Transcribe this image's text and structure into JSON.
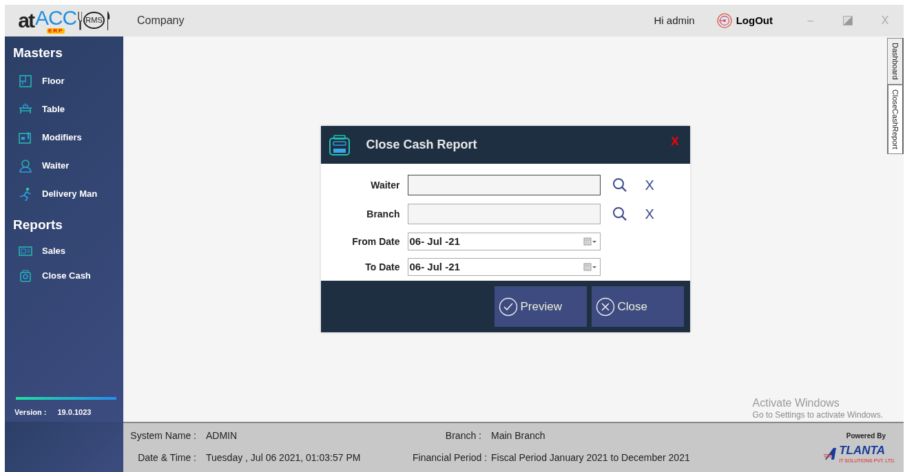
{
  "header": {
    "logo": {
      "brand_dark": "at",
      "brand_light": "ACC",
      "sub": "ERP",
      "badge": "RMS"
    },
    "company": "Company",
    "greeting": "Hi admin",
    "logout": "LogOut",
    "minimize": "–",
    "close": "X"
  },
  "sidebar": {
    "sections": [
      {
        "title": "Masters",
        "items": [
          {
            "label": "Floor"
          },
          {
            "label": "Table"
          },
          {
            "label": "Modifiers"
          },
          {
            "label": "Waiter"
          },
          {
            "label": "Delivery Man"
          }
        ]
      },
      {
        "title": "Reports",
        "items": [
          {
            "label": "Sales"
          },
          {
            "label": "Close Cash"
          }
        ]
      }
    ],
    "version_label": "Version :",
    "version": "19.0.1023"
  },
  "dialog": {
    "title": "Close Cash Report",
    "close": "X",
    "fields": [
      {
        "label": "Waiter",
        "kind": "lookup",
        "clear": "X"
      },
      {
        "label": "Branch",
        "kind": "lookup",
        "clear": "X"
      },
      {
        "label": "From Date",
        "kind": "date",
        "value": "06- Jul -21"
      },
      {
        "label": "To Date",
        "kind": "date",
        "value": "06- Jul -21"
      }
    ],
    "buttons": [
      {
        "label": "Preview",
        "kind": "ok"
      },
      {
        "label": "Close",
        "kind": "cancel"
      }
    ]
  },
  "tabs": [
    {
      "label": "Dashboard",
      "selected": false
    },
    {
      "label": "CloseCashReport",
      "selected": true
    }
  ],
  "watermark": {
    "title": "Activate Windows",
    "hint": "Go to Settings to activate Windows."
  },
  "status_bar": {
    "left": [
      {
        "label": "System Name :",
        "value": "ADMIN"
      },
      {
        "label": "Date & Time :",
        "value": "Tuesday , Jul 06 2021, 01:03:57 PM"
      }
    ],
    "right": [
      {
        "label": "Branch :",
        "value": "Main Branch"
      },
      {
        "label": "Financial Period :",
        "value": "Fiscal Period January 2021 to December 2021"
      }
    ],
    "powered_by": "Powered By",
    "vendor": {
      "name": "TLANTA",
      "tagline": "IT SOLUTIONS PVT. LTD."
    }
  }
}
